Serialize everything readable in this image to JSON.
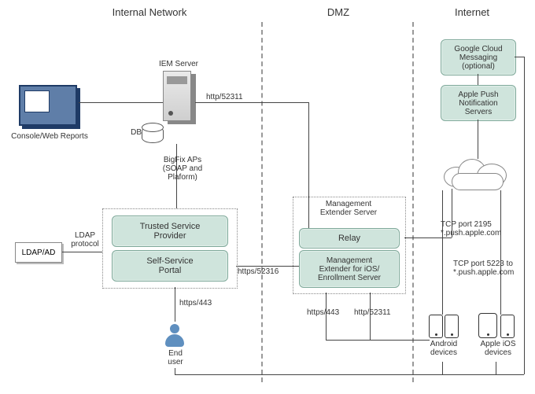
{
  "zones": {
    "internal": "Internal Network",
    "dmz": "DMZ",
    "internet": "Internet"
  },
  "nodes": {
    "console": "Console/Web Reports",
    "iem_server": "IEM Server",
    "db": "DB",
    "ldap": "LDAP/AD",
    "tsp": "Trusted Service\nProvider",
    "ssp": "Self-Service\nPortal",
    "end_user": "End\nuser",
    "mes_group": "Management\nExtender Server",
    "relay": "Relay",
    "me_ios": "Management\nExtender for iOS/\nEnrollment Server",
    "gcm": "Google Cloud\nMessaging\n(optional)",
    "apns": "Apple Push\nNotification\nServers",
    "android_devices": "Android\ndevices",
    "ios_devices": "Apple iOS\ndevices"
  },
  "edges": {
    "iem_to_relay": "http/52311",
    "bigfix_api": "BigFix APs\n(SOAP and\nPlaform)",
    "ldap_protocol": "LDAP\nprotocol",
    "ssp_to_me": "https/52316",
    "ssp_to_user": "https/443",
    "mes_to_android_443": "https/443",
    "mes_to_android_52311": "http/52311",
    "apns_2195": "TCP port 2195\n*.push.apple.com",
    "apns_5223": "TCP port 5223 to\n*.push.apple.com"
  },
  "chart_data": {
    "type": "diagram",
    "zones": [
      "Internal Network",
      "DMZ",
      "Internet"
    ],
    "nodes": [
      {
        "id": "console",
        "label": "Console/Web Reports",
        "zone": "Internal Network"
      },
      {
        "id": "iem",
        "label": "IEM Server",
        "zone": "Internal Network"
      },
      {
        "id": "db",
        "label": "DB",
        "zone": "Internal Network",
        "attached_to": "iem"
      },
      {
        "id": "tsp",
        "label": "Trusted Service Provider",
        "zone": "Internal Network"
      },
      {
        "id": "ssp",
        "label": "Self-Service Portal",
        "zone": "Internal Network"
      },
      {
        "id": "ldap",
        "label": "LDAP/AD",
        "zone": "Internal Network"
      },
      {
        "id": "enduser",
        "label": "End user",
        "zone": "Internal Network"
      },
      {
        "id": "mes",
        "label": "Management Extender Server",
        "zone": "DMZ",
        "children": [
          "relay",
          "me_ios"
        ]
      },
      {
        "id": "relay",
        "label": "Relay",
        "zone": "DMZ"
      },
      {
        "id": "me_ios",
        "label": "Management Extender for iOS / Enrollment Server",
        "zone": "DMZ"
      },
      {
        "id": "gcm",
        "label": "Google Cloud Messaging (optional)",
        "zone": "Internet"
      },
      {
        "id": "apns",
        "label": "Apple Push Notification Servers",
        "zone": "Internet"
      },
      {
        "id": "cloud",
        "label": "Internet cloud",
        "zone": "Internet"
      },
      {
        "id": "android",
        "label": "Android devices",
        "zone": "Internet"
      },
      {
        "id": "ios",
        "label": "Apple iOS devices",
        "zone": "Internet"
      }
    ],
    "edges": [
      {
        "from": "console",
        "to": "iem"
      },
      {
        "from": "iem",
        "to": "relay",
        "label": "http/52311"
      },
      {
        "from": "iem",
        "to": "tsp",
        "label": "BigFix APs (SOAP and Plaform)",
        "via": "ssp-group"
      },
      {
        "from": "ldap",
        "to": "tsp",
        "label": "LDAP protocol"
      },
      {
        "from": "ldap",
        "to": "ssp",
        "label": "LDAP protocol"
      },
      {
        "from": "ssp",
        "to": "me_ios",
        "label": "https/52316"
      },
      {
        "from": "ssp",
        "to": "enduser",
        "label": "https/443"
      },
      {
        "from": "mes",
        "to": "android",
        "label": "https/443"
      },
      {
        "from": "mes",
        "to": "android",
        "label": "http/52311"
      },
      {
        "from": "me_ios",
        "to": "apns",
        "label": "TCP port 2195 *.push.apple.com",
        "via": "cloud"
      },
      {
        "from": "apns",
        "to": "ios",
        "label": "TCP port 5223 to *.push.apple.com",
        "via": "cloud"
      },
      {
        "from": "gcm",
        "to": "android",
        "via": "cloud"
      },
      {
        "from": "gcm",
        "to": "cloud"
      },
      {
        "from": "enduser",
        "to": "android"
      },
      {
        "from": "enduser",
        "to": "ios"
      }
    ]
  }
}
